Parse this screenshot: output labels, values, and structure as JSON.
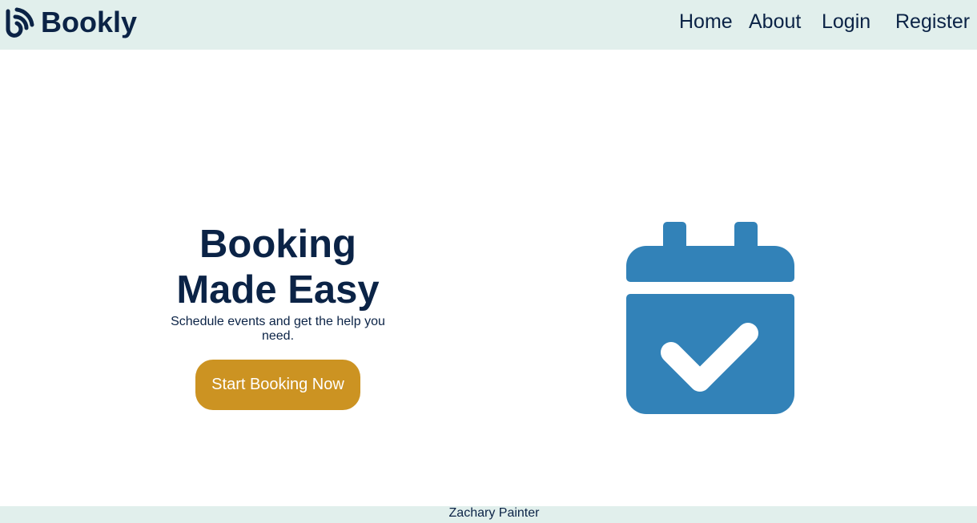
{
  "nav": {
    "brand_name": "Bookly",
    "brand_icon": "rss-hook-logo-icon",
    "links": [
      {
        "label": "Home"
      },
      {
        "label": "About"
      },
      {
        "label": "Login"
      },
      {
        "label": "Register"
      }
    ]
  },
  "hero": {
    "title_line1": "Booking",
    "title_line2": "Made Easy",
    "subtitle": "Schedule events and get the help you need.",
    "cta_label": "Start Booking Now",
    "illustration_icon": "calendar-check-icon"
  },
  "footer": {
    "text": "Zachary Painter"
  },
  "colors": {
    "navy": "#0b2346",
    "mint_background": "#e1efec",
    "cta_gold": "#cc9322",
    "calendar_blue": "#3282b8",
    "white": "#ffffff"
  }
}
